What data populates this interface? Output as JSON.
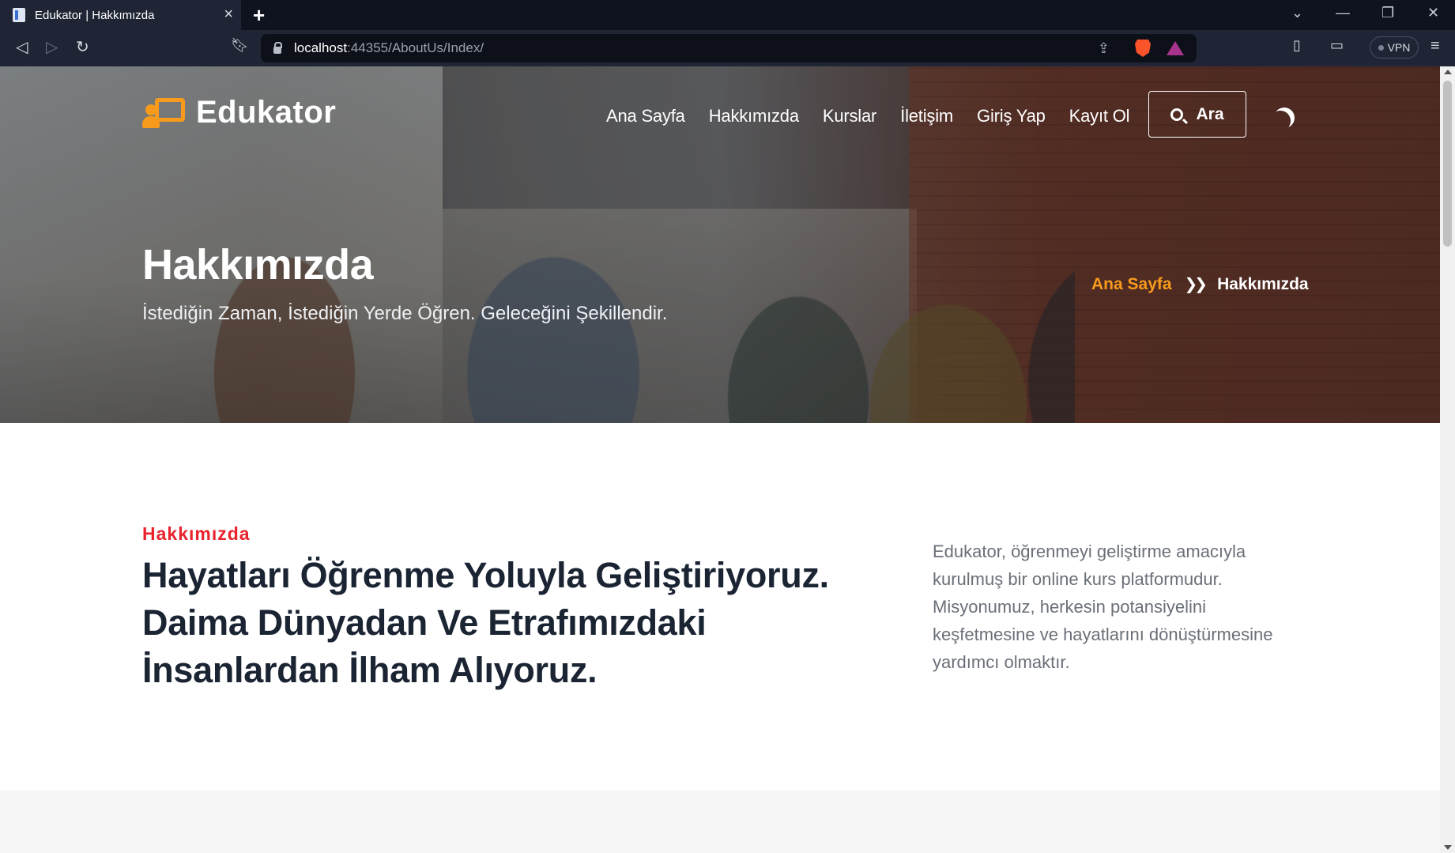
{
  "browser": {
    "tab_title": "Edukator | Hakkımızda",
    "url_host": "localhost",
    "url_rest": ":44355/AboutUs/Index/",
    "vpn_label": "VPN"
  },
  "site": {
    "logo": "Edukator",
    "nav": [
      "Ana Sayfa",
      "Hakkımızda",
      "Kurslar",
      "İletişim",
      "Giriş Yap",
      "Kayıt Ol"
    ],
    "search_label": "Ara"
  },
  "hero": {
    "title": "Hakkımızda",
    "subtitle": "İstediğin Zaman, İstediğin Yerde Öğren. Geleceğini Şekillendir.",
    "breadcrumb_home": "Ana Sayfa",
    "breadcrumb_current": "Hakkımızda"
  },
  "about": {
    "eyebrow": "Hakkımızda",
    "heading": "Hayatları Öğrenme Yoluyla Geliştiriyoruz. Daima Dünyadan Ve Etrafımızdaki İnsanlardan İlham Alıyoruz.",
    "description": "Edukator, öğrenmeyi geliştirme amacıyla kurulmuş bir online kurs platformudur. Misyonumuz, herkesin potansiyelini keşfetmesine ve hayatlarını dönüştürmesine yardımcı olmaktır."
  },
  "colors": {
    "accent_orange": "#f89a1c",
    "eyebrow_red": "#e8232e",
    "heading_dark": "#1b2433"
  }
}
